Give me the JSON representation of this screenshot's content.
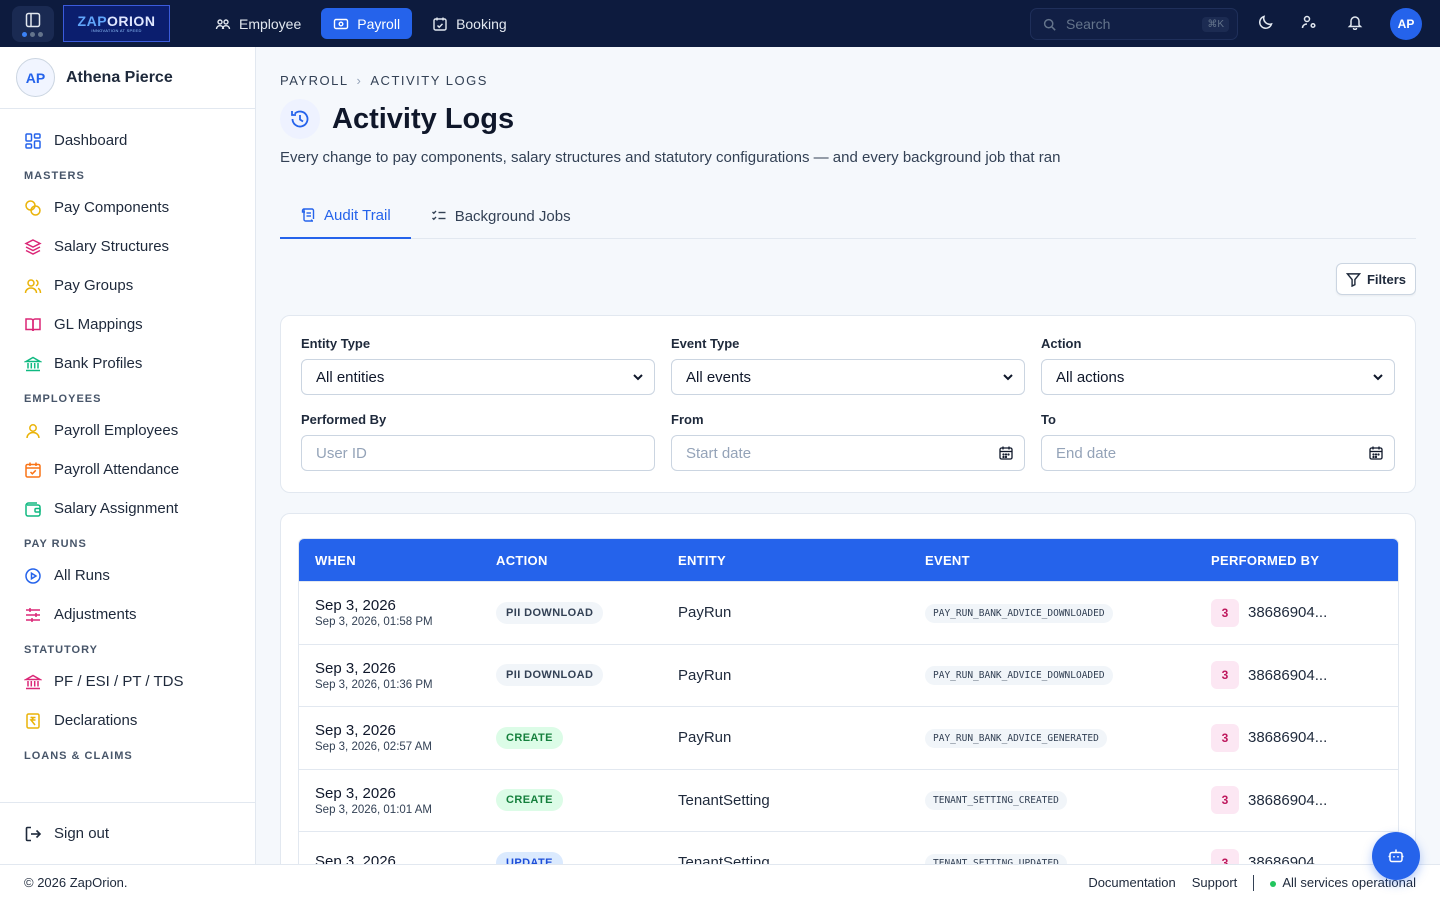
{
  "topbar": {
    "logo_text": "ZAPORION",
    "logo_tagline": "INNOVATION AT SPEED",
    "nav": [
      {
        "label": "Employee",
        "icon": "users-icon"
      },
      {
        "label": "Payroll",
        "icon": "wallet-icon",
        "active": true
      },
      {
        "label": "Booking",
        "icon": "calendar-icon"
      }
    ],
    "search_placeholder": "Search",
    "search_shortcut": "⌘K",
    "user_initials": "AP"
  },
  "sidebar": {
    "user_initials": "AP",
    "user_name": "Athena Pierce",
    "dashboard": "Dashboard",
    "sections": [
      {
        "title": "MASTERS",
        "items": [
          "Pay Components",
          "Salary Structures",
          "Pay Groups",
          "GL Mappings",
          "Bank Profiles"
        ]
      },
      {
        "title": "EMPLOYEES",
        "items": [
          "Payroll Employees",
          "Payroll Attendance",
          "Salary Assignment"
        ]
      },
      {
        "title": "PAY RUNS",
        "items": [
          "All Runs",
          "Adjustments"
        ]
      },
      {
        "title": "STATUTORY",
        "items": [
          "PF / ESI / PT / TDS",
          "Declarations"
        ]
      },
      {
        "title": "LOANS & CLAIMS",
        "items": []
      }
    ],
    "sign_out": "Sign out"
  },
  "page": {
    "breadcrumb": [
      "PAYROLL",
      "ACTIVITY LOGS"
    ],
    "title": "Activity Logs",
    "subtitle": "Every change to pay components, salary structures and statutory configurations — and every background job that ran",
    "tabs": [
      {
        "label": "Audit Trail",
        "active": true
      },
      {
        "label": "Background Jobs",
        "active": false
      }
    ],
    "filters_button": "Filters"
  },
  "filters": {
    "entity_type": {
      "label": "Entity Type",
      "value": "All entities"
    },
    "event_type": {
      "label": "Event Type",
      "value": "All events"
    },
    "action": {
      "label": "Action",
      "value": "All actions"
    },
    "performed_by": {
      "label": "Performed By",
      "placeholder": "User ID"
    },
    "from": {
      "label": "From",
      "placeholder": "Start date"
    },
    "to": {
      "label": "To",
      "placeholder": "End date"
    }
  },
  "table": {
    "columns": [
      "WHEN",
      "ACTION",
      "ENTITY",
      "EVENT",
      "PERFORMED BY"
    ],
    "rows": [
      {
        "when": "Sep 3, 2026",
        "when_detail": "Sep 3, 2026, 01:58 PM",
        "action": "PII DOWNLOAD",
        "action_type": "pii",
        "entity": "PayRun",
        "event": "PAY_RUN_BANK_ADVICE_DOWNLOADED",
        "performer_badge": "3",
        "performer_id": "38686904..."
      },
      {
        "when": "Sep 3, 2026",
        "when_detail": "Sep 3, 2026, 01:36 PM",
        "action": "PII DOWNLOAD",
        "action_type": "pii",
        "entity": "PayRun",
        "event": "PAY_RUN_BANK_ADVICE_DOWNLOADED",
        "performer_badge": "3",
        "performer_id": "38686904..."
      },
      {
        "when": "Sep 3, 2026",
        "when_detail": "Sep 3, 2026, 02:57 AM",
        "action": "CREATE",
        "action_type": "create",
        "entity": "PayRun",
        "event": "PAY_RUN_BANK_ADVICE_GENERATED",
        "performer_badge": "3",
        "performer_id": "38686904..."
      },
      {
        "when": "Sep 3, 2026",
        "when_detail": "Sep 3, 2026, 01:01 AM",
        "action": "CREATE",
        "action_type": "create",
        "entity": "TenantSetting",
        "event": "TENANT_SETTING_CREATED",
        "performer_badge": "3",
        "performer_id": "38686904..."
      },
      {
        "when": "Sep 3, 2026",
        "when_detail": "",
        "action": "UPDATE",
        "action_type": "update",
        "entity": "TenantSetting",
        "event": "TENANT_SETTING_UPDATED",
        "performer_badge": "3",
        "performer_id": "38686904..."
      }
    ]
  },
  "footer": {
    "copyright": "© 2026 ZapOrion.",
    "documentation": "Documentation",
    "support": "Support",
    "status": "All services operational"
  },
  "colors": {
    "primary": "#2563eb",
    "topbar": "#0d1b3e",
    "status_ok": "#22c55e"
  }
}
